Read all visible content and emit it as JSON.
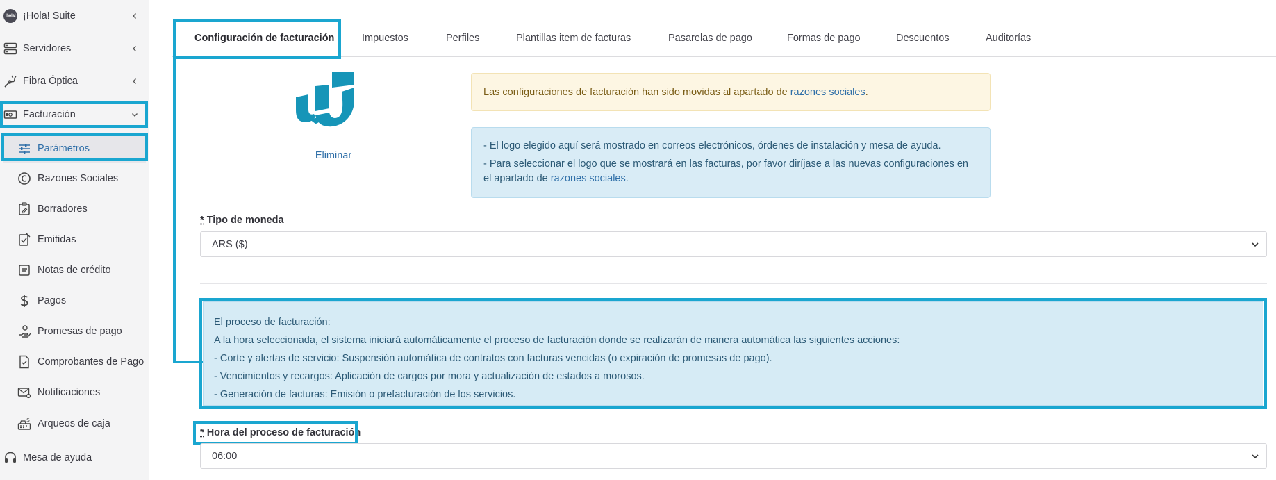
{
  "sidebar": {
    "items": [
      {
        "label": "¡Hola! Suite",
        "icon": "hola-logo-icon"
      },
      {
        "label": "Servidores",
        "icon": "server-icon"
      },
      {
        "label": "Fibra Óptica",
        "icon": "fiber-icon"
      },
      {
        "label": "Facturación",
        "icon": "billing-icon"
      }
    ],
    "logo_text": "¡hola!",
    "sub_items": [
      {
        "label": "Parámetros",
        "icon": "sliders-icon",
        "active": true
      },
      {
        "label": "Razones Sociales",
        "icon": "copyright-icon"
      },
      {
        "label": "Borradores",
        "icon": "draft-icon"
      },
      {
        "label": "Emitidas",
        "icon": "issued-icon"
      },
      {
        "label": "Notas de crédito",
        "icon": "credit-note-icon"
      },
      {
        "label": "Pagos",
        "icon": "dollar-icon"
      },
      {
        "label": "Promesas de pago",
        "icon": "hand-coin-icon"
      },
      {
        "label": "Comprobantes de Pago",
        "icon": "receipt-icon"
      },
      {
        "label": "Notificaciones",
        "icon": "mail-icon"
      },
      {
        "label": "Arqueos de caja",
        "icon": "cash-register-icon"
      }
    ],
    "help": {
      "label": "Mesa de ayuda",
      "icon": "headset-icon"
    }
  },
  "tabs": [
    {
      "label": "Configuración de facturación",
      "active": true
    },
    {
      "label": "Impuestos"
    },
    {
      "label": "Perfiles"
    },
    {
      "label": "Plantillas item de facturas"
    },
    {
      "label": "Pasarelas de pago"
    },
    {
      "label": "Formas de pago"
    },
    {
      "label": "Descuentos"
    },
    {
      "label": "Auditorías"
    }
  ],
  "logo": {
    "delete_label": "Eliminar"
  },
  "alerts": {
    "warning_text": "Las configuraciones de facturación han sido movidas al apartado de ",
    "warning_link": "razones sociales",
    "warning_end": ".",
    "info_line1": "- El logo elegido aquí será mostrado en correos electrónicos, órdenes de instalación y mesa de ayuda.",
    "info_line2a": "- Para seleccionar el logo que se mostrará en las facturas, por favor diríjase a las nuevas configuraciones en el apartado de ",
    "info_line2_link": "razones sociales",
    "info_line2_end": "."
  },
  "currency": {
    "required_mark": "*",
    "label": "Tipo de moneda",
    "value": "ARS ($)"
  },
  "process": {
    "lines": [
      "El proceso de facturación:",
      "A la hora seleccionada, el sistema iniciará automáticamente el proceso de facturación donde se realizarán de manera automática las siguientes acciones:",
      "- Corte y alertas de servicio: Suspensión automática de contratos con facturas vencidas (o expiración de promesas de pago).",
      "- Vencimientos y recargos: Aplicación de cargos por mora y actualización de estados a morosos.",
      "- Generación de facturas: Emisión o prefacturación de los servicios."
    ]
  },
  "billing_hour": {
    "required_mark": "*",
    "label": "Hora del proceso de facturación",
    "value": "06:00"
  },
  "colors": {
    "accent_highlight": "#1aa6d0",
    "link": "#2f6fa8",
    "logo_teal": "#1695b8"
  }
}
